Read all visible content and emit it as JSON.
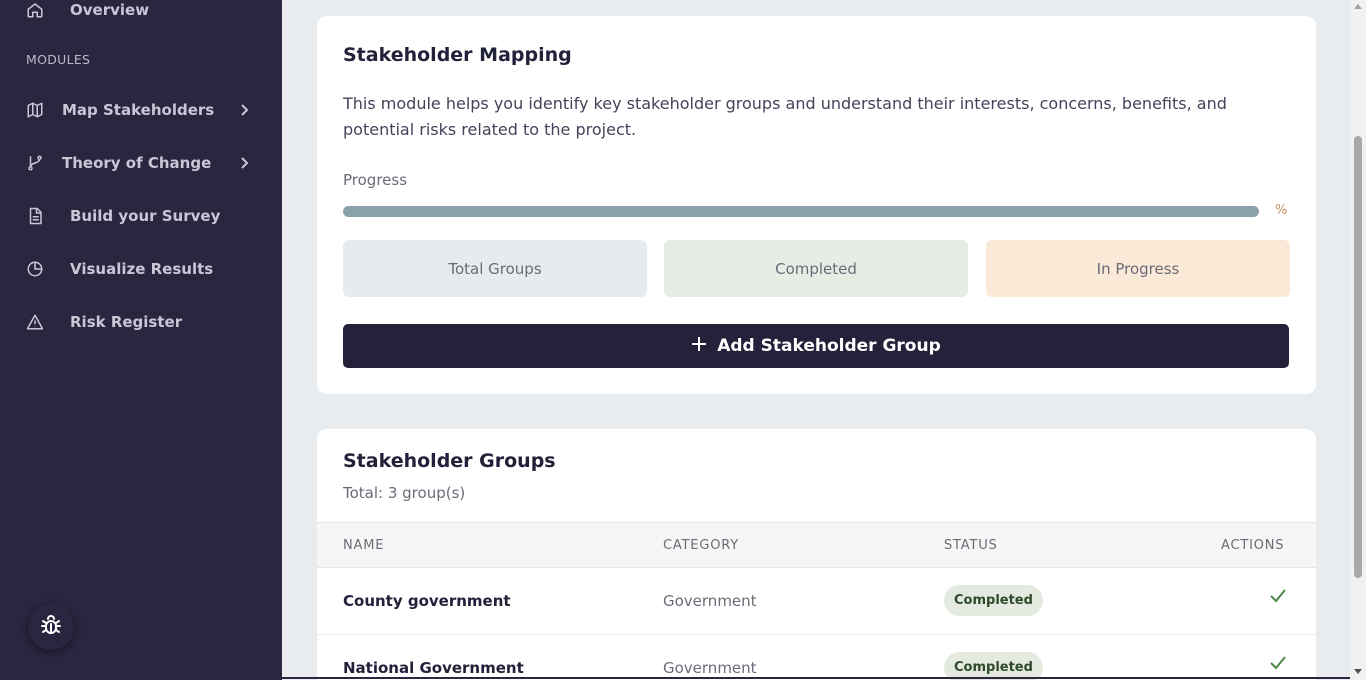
{
  "sidebar": {
    "overview_label": "Overview",
    "section_label": "MODULES",
    "items": [
      {
        "label": "Map Stakeholders",
        "icon": "map-icon",
        "has_chevron": true
      },
      {
        "label": "Theory of Change",
        "icon": "git-branch-icon",
        "has_chevron": true
      },
      {
        "label": "Build your Survey",
        "icon": "document-icon",
        "has_chevron": false
      },
      {
        "label": "Visualize Results",
        "icon": "pie-chart-icon",
        "has_chevron": false
      },
      {
        "label": "Risk Register",
        "icon": "warning-icon",
        "has_chevron": false
      }
    ],
    "debug_icon": "bug-icon"
  },
  "module": {
    "title": "Stakeholder Mapping",
    "description": "This module helps you identify key stakeholder groups and understand their interests, concerns, benefits, and potential risks related to the project.",
    "progress_label": "Progress",
    "progress_value_text": "%",
    "stats": {
      "total_label": "Total Groups",
      "completed_label": "Completed",
      "in_progress_label": "In Progress"
    },
    "add_button_label": "Add Stakeholder Group"
  },
  "groups": {
    "title": "Stakeholder Groups",
    "subtitle": "Total: 3 group(s)",
    "columns": [
      "NAME",
      "CATEGORY",
      "STATUS",
      "ACTIONS"
    ],
    "rows": [
      {
        "name": "County government",
        "category": "Government",
        "status": "Completed"
      },
      {
        "name": "National Government",
        "category": "Government",
        "status": "Completed"
      }
    ]
  },
  "colors": {
    "sidebar_bg": "#2b2540",
    "primary_button": "#25213a",
    "progress_track": "#8aa0ab",
    "percent_text": "#c4925a",
    "completed_badge_bg": "#e4eadf",
    "check_green": "#4d8a4a"
  }
}
